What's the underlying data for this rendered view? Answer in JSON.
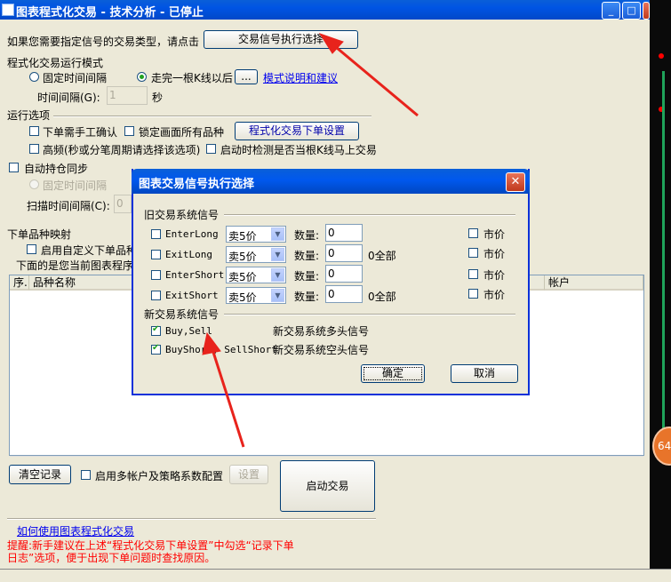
{
  "window": {
    "title": "图表程式化交易 - 技术分析 - 已停止",
    "min_icon": "minimize-icon",
    "max_icon": "maximize-icon",
    "close_icon": "close-icon"
  },
  "top": {
    "prompt": "如果您需要指定信号的交易类型，请点击",
    "signal_button": "交易信号执行选择"
  },
  "mode": {
    "section": "程式化交易运行模式",
    "fixed_interval": "固定时间间隔",
    "after_kline": "走完一根K线以后",
    "ellipsis_button": "...",
    "mode_link": "模式说明和建议",
    "interval_label": "时间间隔(G):",
    "interval_value": "1",
    "interval_unit": "秒"
  },
  "run": {
    "section": "运行选项",
    "manual_confirm": "下单需手工确认",
    "lock_all": "锁定画面所有品种",
    "order_settings_button": "程式化交易下单设置",
    "high_freq": "高频(秒或分笔周期请选择该选项)",
    "startup_check": "启动时检测是否当根K线马上交易"
  },
  "sync": {
    "auto_sync": "自动持仓同步",
    "fixed_interval": "固定时间间隔",
    "scan_label": "扫描时间间隔(C):",
    "scan_value": "0"
  },
  "mapping": {
    "section": "下单品种映射",
    "custom_enable": "启用自定义下单品种",
    "desc": "下面的是您当前图表程序"
  },
  "table": {
    "columns": [
      "序.",
      "品种名称",
      "帐户"
    ]
  },
  "bottom": {
    "clear_button": "清空记录",
    "multi_account": "启用多帐户及策略系数配置",
    "settings_button": "设置",
    "start_button": "启动交易",
    "help_link": "如何使用图表程式化交易",
    "tip": "提醒:新手建议在上述“程式化交易下单设置”中勾选“记录下单日志”选项，便于出现下单问题时查找原因。"
  },
  "dialog": {
    "title": "图表交易信号执行选择",
    "close_icon": "close-icon",
    "old_section": "旧交易系统信号",
    "new_section": "新交易系统信号",
    "qty_label": "数量:",
    "market_label": "市价",
    "rows": [
      {
        "signal": "EnterLong",
        "price": "卖5价",
        "qty": "0",
        "note": ""
      },
      {
        "signal": "ExitLong",
        "price": "卖5价",
        "qty": "0",
        "note": "0全部"
      },
      {
        "signal": "EnterShort",
        "price": "卖5价",
        "qty": "0",
        "note": ""
      },
      {
        "signal": "ExitShort",
        "price": "卖5价",
        "qty": "0",
        "note": "0全部"
      }
    ],
    "new_rows": [
      {
        "signal": "Buy,Sell",
        "desc": "新交易系统多头信号",
        "checked": true
      },
      {
        "signal": "BuyShort, SellShort",
        "desc": "新交易系统空头信号",
        "checked": true
      }
    ],
    "ok_button": "确定",
    "cancel_button": "取消"
  },
  "side_badge": "64",
  "colors": {
    "title_blue": "#0054e3",
    "arrow_red": "#e8231c",
    "link_blue": "#0000ee",
    "tip_red": "#ff0000"
  }
}
